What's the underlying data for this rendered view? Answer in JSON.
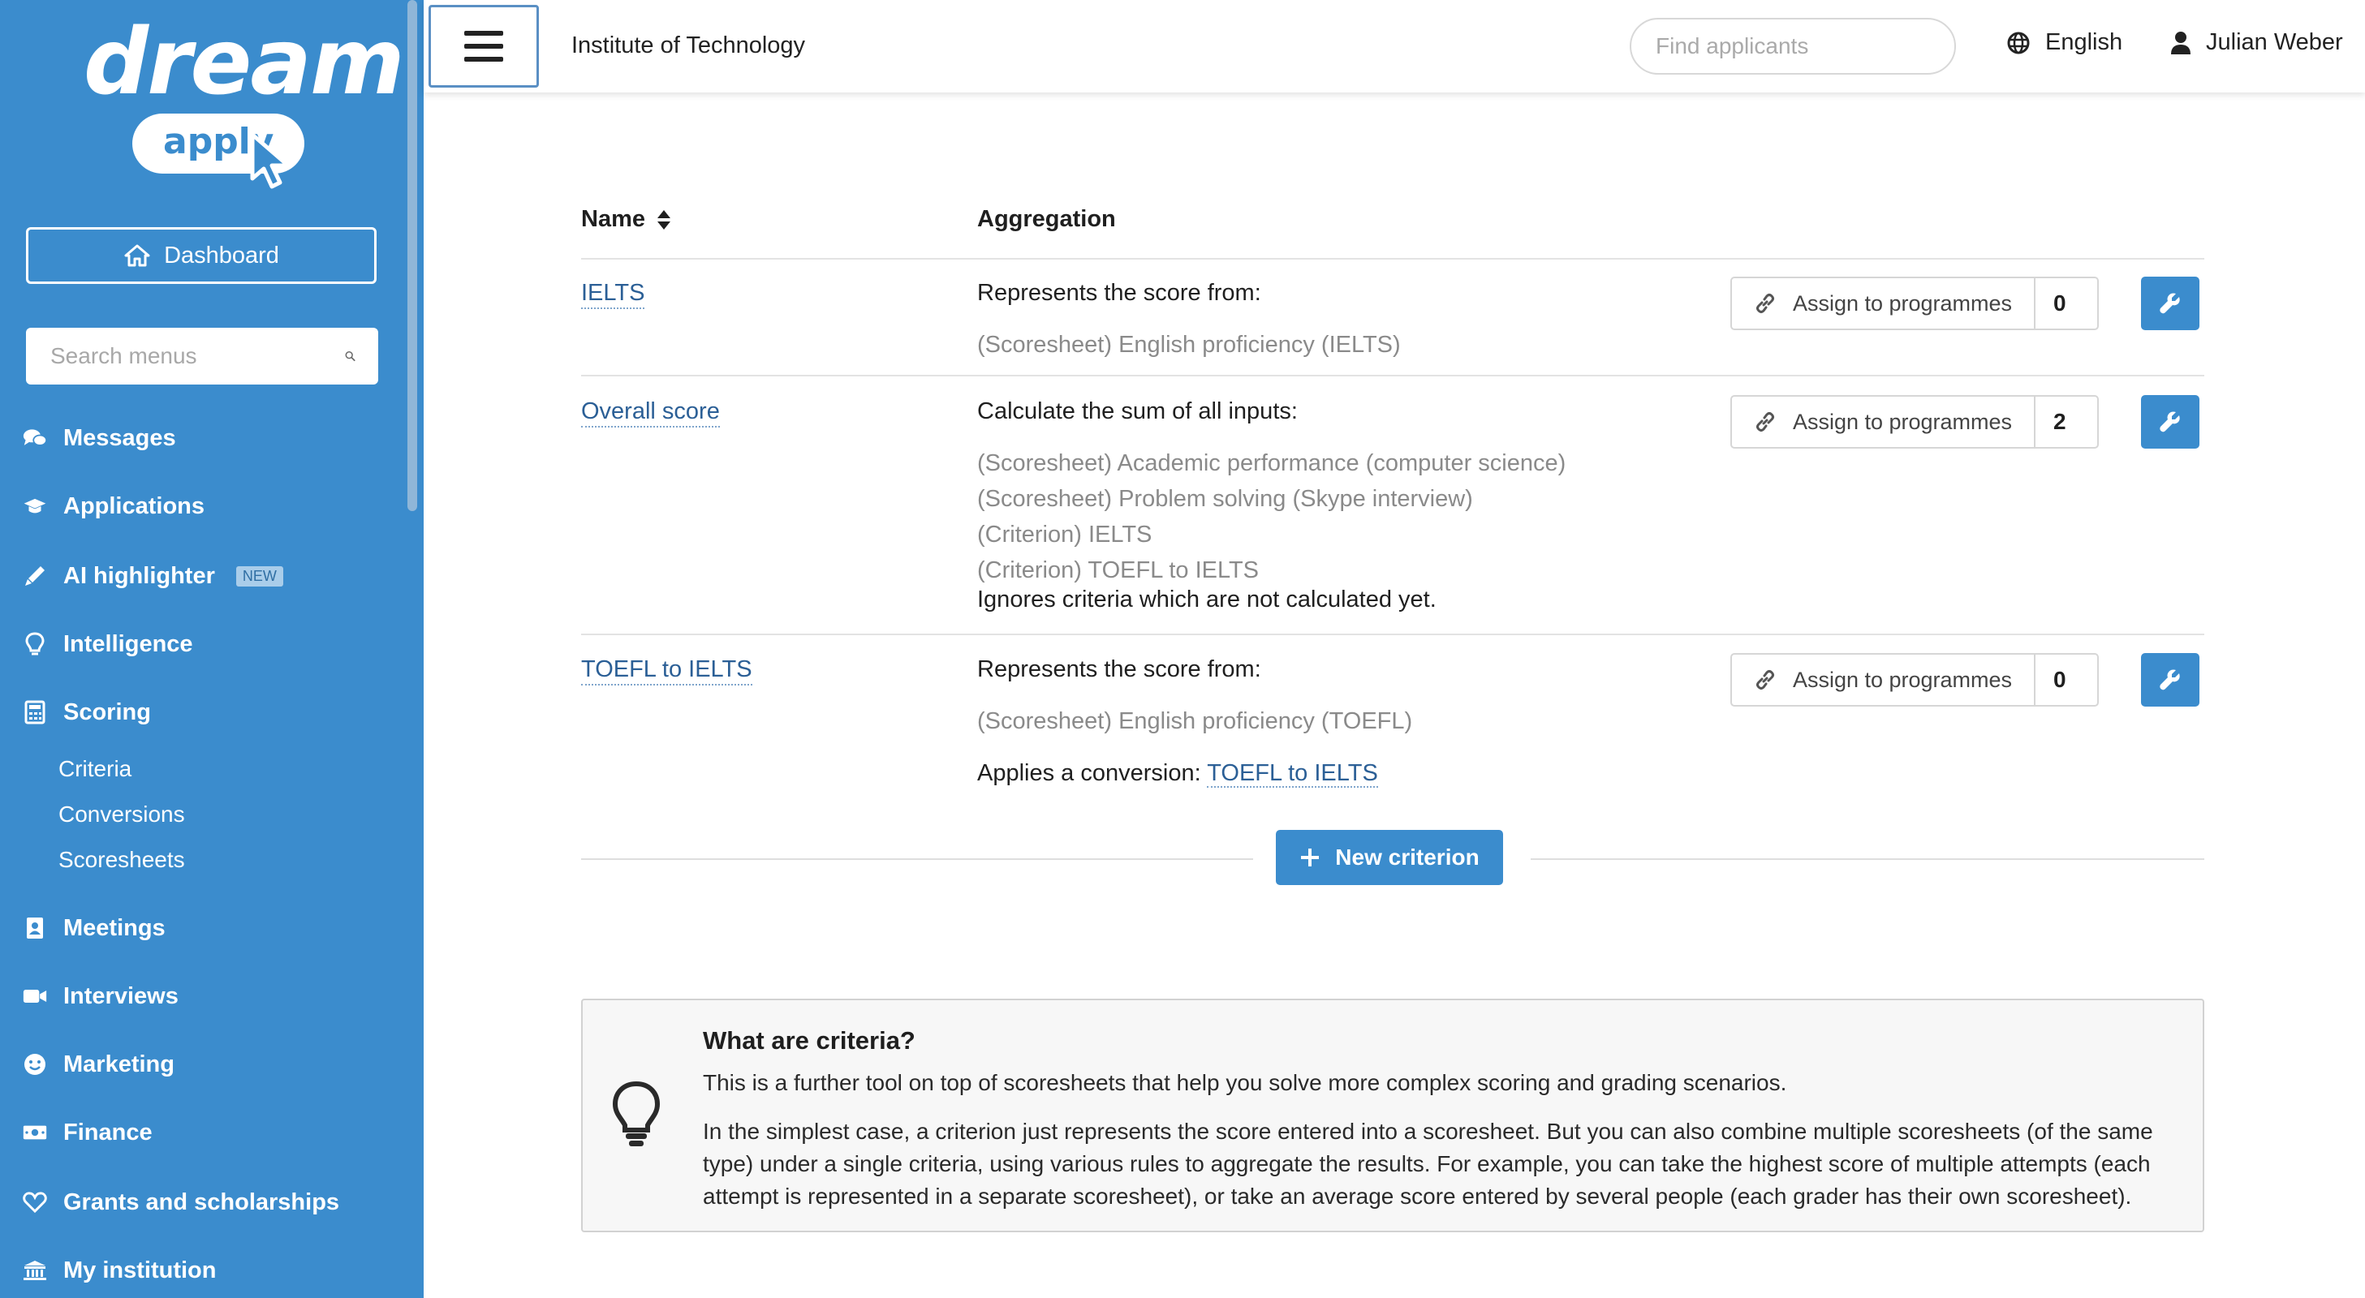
{
  "brand": {
    "logo_word": "dream",
    "logo_badge": "apply"
  },
  "sidebar": {
    "dashboard_label": "Dashboard",
    "search_placeholder": "Search menus",
    "items": [
      {
        "label": "Messages",
        "icon": "chat-icon"
      },
      {
        "label": "Applications",
        "icon": "graduation-cap-icon"
      },
      {
        "label": "AI highlighter",
        "icon": "highlighter-icon",
        "badge": "NEW"
      },
      {
        "label": "Intelligence",
        "icon": "lightbulb-icon"
      },
      {
        "label": "Scoring",
        "icon": "calculator-icon",
        "children": [
          {
            "label": "Criteria"
          },
          {
            "label": "Conversions"
          },
          {
            "label": "Scoresheets"
          }
        ]
      },
      {
        "label": "Meetings",
        "icon": "address-book-icon"
      },
      {
        "label": "Interviews",
        "icon": "video-camera-icon"
      },
      {
        "label": "Marketing",
        "icon": "smile-icon"
      },
      {
        "label": "Finance",
        "icon": "money-bill-icon"
      },
      {
        "label": "Grants and scholarships",
        "icon": "heart-icon"
      },
      {
        "label": "My institution",
        "icon": "institution-icon"
      }
    ]
  },
  "topbar": {
    "institution": "Institute of Technology",
    "search_placeholder": "Find applicants",
    "language": "English",
    "user": "Julian Weber"
  },
  "table": {
    "headers": {
      "name": "Name",
      "aggregation": "Aggregation"
    },
    "assign_label": "Assign to programmes",
    "rows": [
      {
        "name": "IELTS",
        "aggregation_head": "Represents the score from:",
        "inputs": [
          "(Scoresheet) English proficiency (IELTS)"
        ],
        "assigned_count": "0"
      },
      {
        "name": "Overall score",
        "aggregation_head": "Calculate the sum of all inputs:",
        "inputs": [
          "(Scoresheet) Academic performance (computer science)",
          "(Scoresheet) Problem solving (Skype interview)",
          "(Criterion) IELTS",
          "(Criterion) TOEFL to IELTS"
        ],
        "note": "Ignores criteria which are not calculated yet.",
        "assigned_count": "2"
      },
      {
        "name": "TOEFL to IELTS",
        "aggregation_head": "Represents the score from:",
        "inputs": [
          "(Scoresheet) English proficiency (TOEFL)"
        ],
        "note_prefix": "Applies a conversion:",
        "note_link": "TOEFL to IELTS",
        "assigned_count": "0"
      }
    ],
    "new_button": "New criterion"
  },
  "info": {
    "title": "What are criteria?",
    "p1": "This is a further tool on top of scoresheets that help you solve more complex scoring and grading scenarios.",
    "p2": "In the simplest case, a criterion just represents the score entered into a scoresheet. But you can also combine multiple scoresheets (of the same type) under a single criteria, using various rules to aggregate the results. For example, you can take the highest score of multiple attempts (each attempt is represented in a separate scoresheet), or take an average score entered by several people (each grader has their own scoresheet)."
  },
  "colors": {
    "sidebar": "#3b8ccd",
    "link": "#2b5f96",
    "button": "#3b8ccd"
  }
}
